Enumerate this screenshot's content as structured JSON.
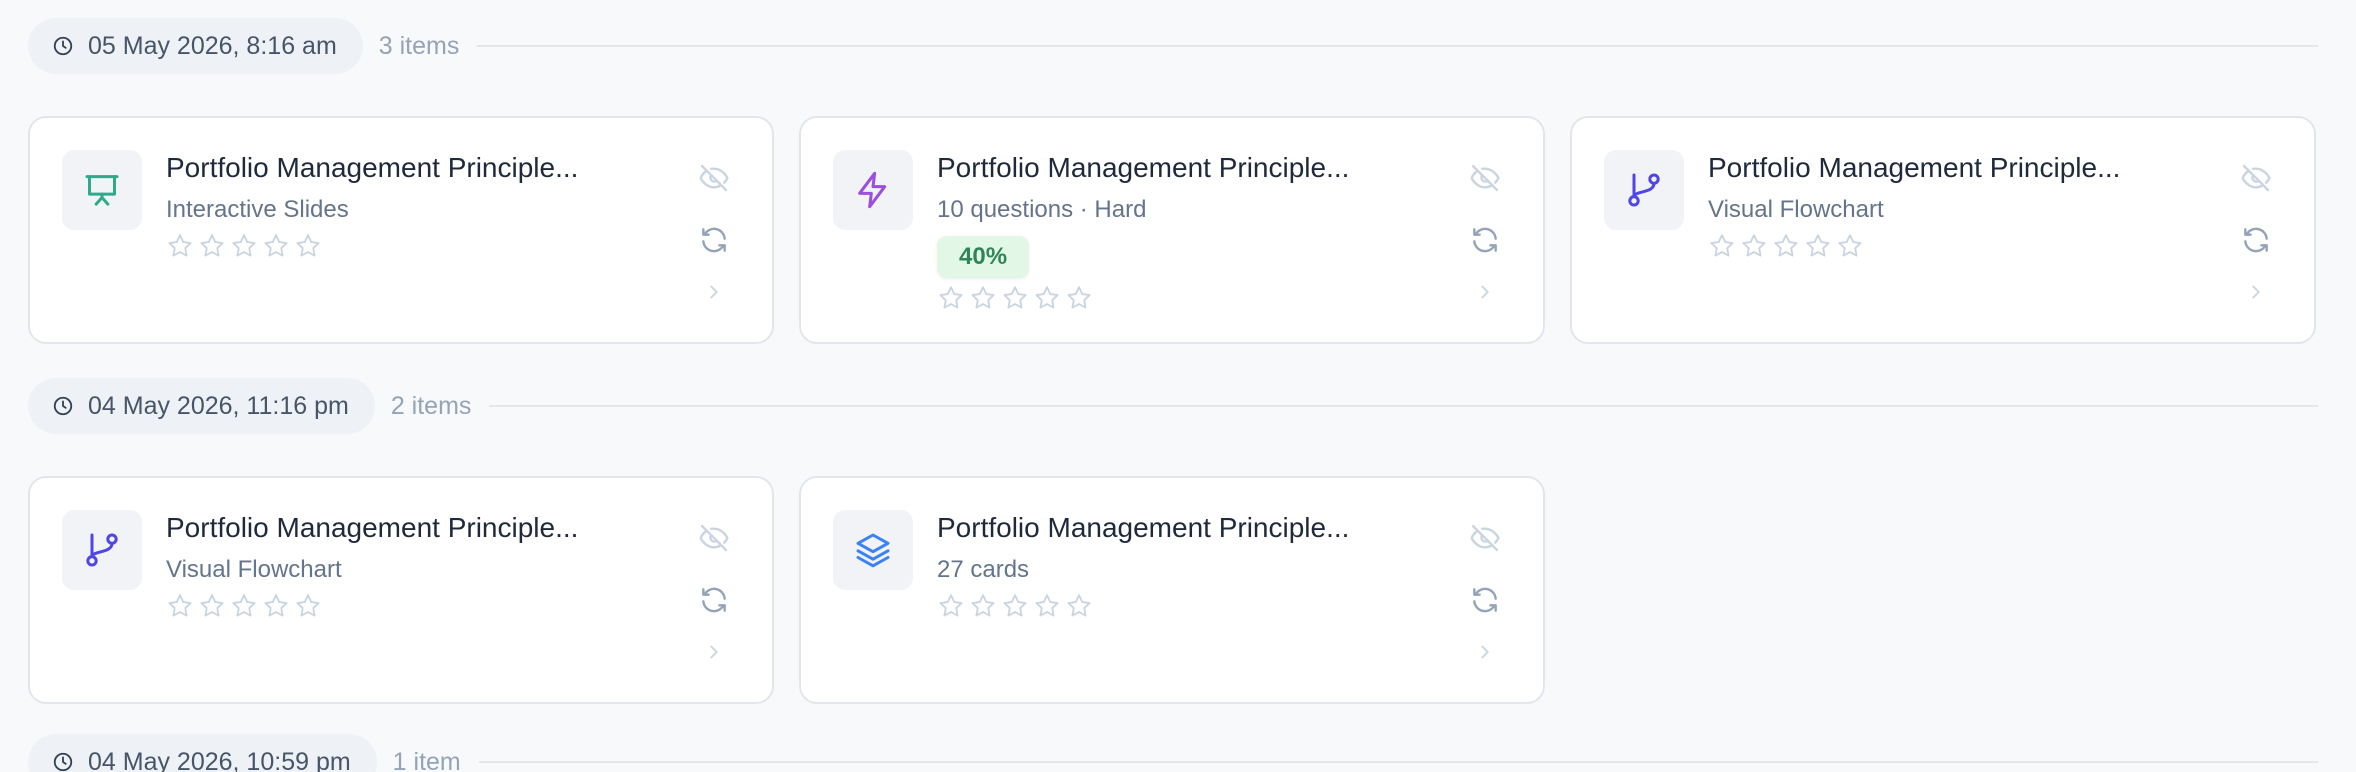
{
  "colors": {
    "slides": "#2fa98c",
    "quiz": "#9b4fdd",
    "flowchart": "#4f46e5",
    "cards": "#3b82f6",
    "muted_icon": "#cbd5e1",
    "score_text": "#2f855a",
    "score_bg": "#e3f7e7"
  },
  "groups": [
    {
      "date": "05 May 2026, 8:16 am",
      "count": "3 items",
      "items": [
        {
          "title": "Portfolio Management Principle...",
          "subtitle": "Interactive Slides",
          "icon": "presentation-icon",
          "rating": 0,
          "score": null
        },
        {
          "title": "Portfolio Management Principle...",
          "subtitle": "10 questions · Hard",
          "icon": "lightning-icon",
          "rating": 0,
          "score": "40%"
        },
        {
          "title": "Portfolio Management Principle...",
          "subtitle": "Visual Flowchart",
          "icon": "git-branch-icon",
          "rating": 0,
          "score": null
        }
      ]
    },
    {
      "date": "04 May 2026, 11:16 pm",
      "count": "2 items",
      "items": [
        {
          "title": "Portfolio Management Principle...",
          "subtitle": "Visual Flowchart",
          "icon": "git-branch-icon",
          "rating": 0,
          "score": null
        },
        {
          "title": "Portfolio Management Principle...",
          "subtitle": "27 cards",
          "icon": "layers-icon",
          "rating": 0,
          "score": null
        }
      ]
    },
    {
      "date": "04 May 2026, 10:59 pm",
      "count": "1 item",
      "items": []
    }
  ]
}
